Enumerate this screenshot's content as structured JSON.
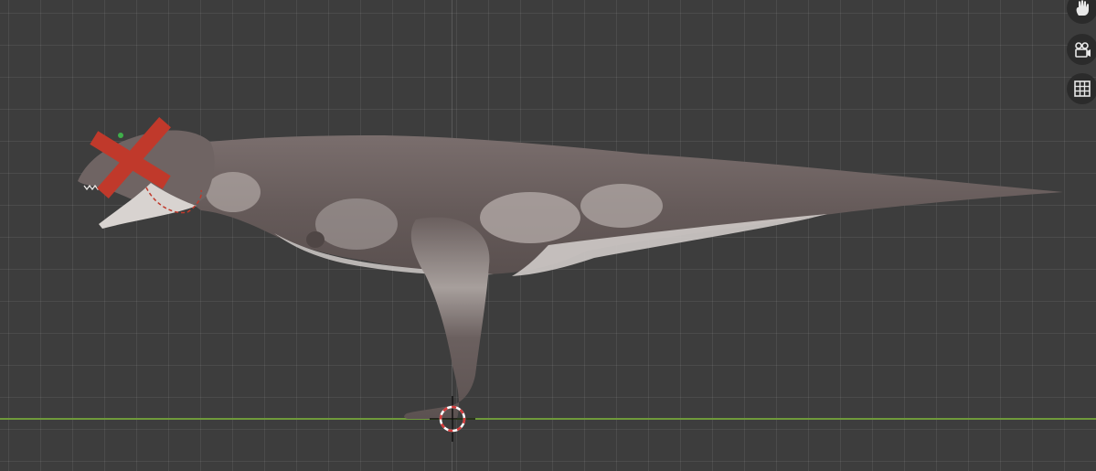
{
  "viewport": {
    "background_color": "#3d3d3d",
    "x_axis_color": "#6f9a3b",
    "selection_marker_color": "#c0392b"
  },
  "navigation_gizmo": {
    "buttons": [
      {
        "icon": "hand-pan-icon"
      },
      {
        "icon": "camera-view-icon"
      },
      {
        "icon": "grid-ortho-icon"
      }
    ]
  },
  "model": {
    "type": "dinosaur-mesh",
    "skin_color": "#6b5f5e",
    "belly_color": "#cfcac8"
  }
}
